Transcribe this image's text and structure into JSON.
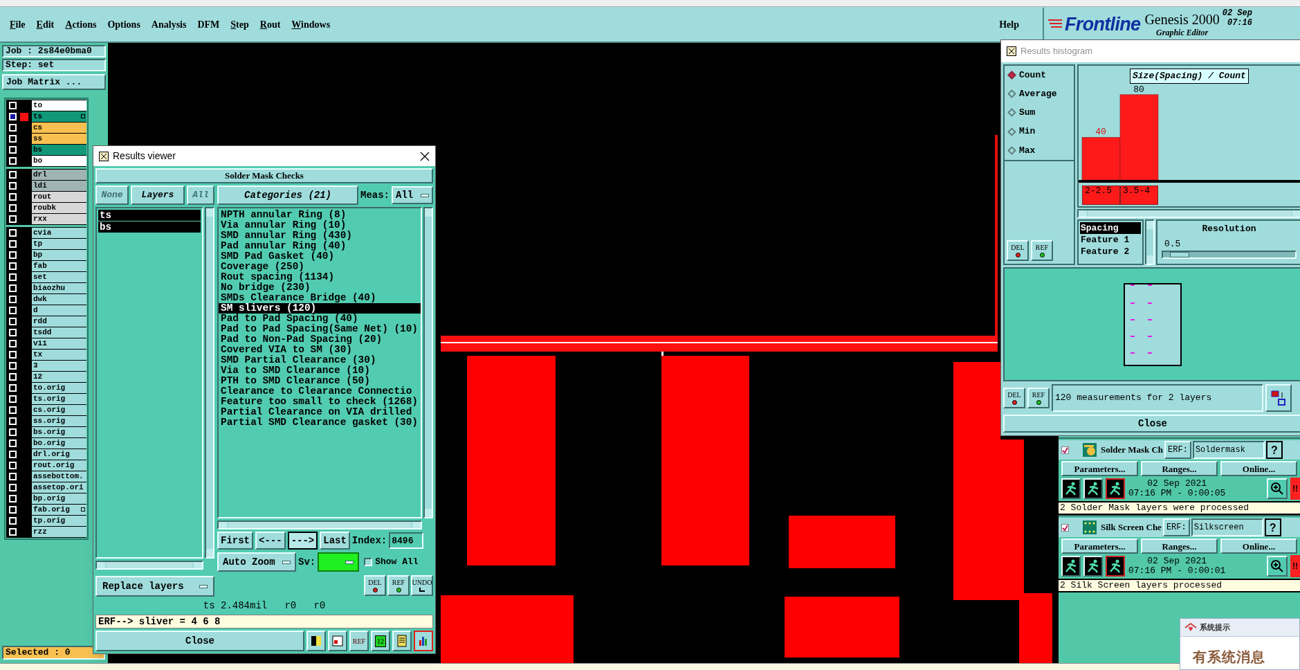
{
  "menu_bar": {
    "items": [
      {
        "label": "File",
        "mnemonic": true
      },
      {
        "label": "Edit",
        "mnemonic": true
      },
      {
        "label": "Actions",
        "mnemonic": true
      },
      {
        "label": "Options",
        "mnemonic": false
      },
      {
        "label": "Analysis",
        "mnemonic": false
      },
      {
        "label": "DFM",
        "mnemonic": false
      },
      {
        "label": "Step",
        "mnemonic": true
      },
      {
        "label": "Rout",
        "mnemonic": true
      },
      {
        "label": "Windows",
        "mnemonic": true
      }
    ],
    "help": {
      "label": "Help",
      "mnemonic": false
    }
  },
  "logo": {
    "brand": "Frontline",
    "product": "Genesis 2000",
    "subtitle": "Graphic Editor",
    "date": "02 Sep",
    "time": "07:16"
  },
  "job_panel": {
    "job": "Job : 2s84e0bma0",
    "step": "Step: set",
    "matrix_button": "Job Matrix ...",
    "layer_groups": [
      [
        {
          "name": "to",
          "color": "#ffffff",
          "selected": false
        },
        {
          "name": "ts",
          "color": "#109878",
          "selected": true,
          "flag": true
        },
        {
          "name": "cs",
          "color": "#f8c050",
          "selected": false
        },
        {
          "name": "ss",
          "color": "#f8c050",
          "selected": false
        },
        {
          "name": "bs",
          "color": "#109878",
          "selected": false
        },
        {
          "name": "bo",
          "color": "#ffffff",
          "selected": false
        }
      ],
      [
        {
          "name": "drl",
          "color": "#a0b4b4",
          "selected": false
        },
        {
          "name": "ldi",
          "color": "#a0b4b4",
          "selected": false
        },
        {
          "name": "rout",
          "color": "#d8d8d8",
          "selected": false
        },
        {
          "name": "roubk",
          "color": "#d8d8d8",
          "selected": false
        },
        {
          "name": "rxx",
          "color": "#d8d8d8",
          "selected": false
        }
      ],
      [
        {
          "name": "cvia",
          "color": "#a0dcdc",
          "selected": false
        },
        {
          "name": "tp",
          "color": "#a0dcdc",
          "selected": false
        },
        {
          "name": "bp",
          "color": "#a0dcdc",
          "selected": false
        },
        {
          "name": "fab",
          "color": "#a0dcdc",
          "selected": false
        },
        {
          "name": "set",
          "color": "#a0dcdc",
          "selected": false
        },
        {
          "name": "biaozhu",
          "color": "#a0dcdc",
          "selected": false
        },
        {
          "name": "dwk",
          "color": "#a0dcdc",
          "selected": false
        },
        {
          "name": "d",
          "color": "#a0dcdc",
          "selected": false
        },
        {
          "name": "rdd",
          "color": "#a0dcdc",
          "selected": false
        },
        {
          "name": "tsdd",
          "color": "#a0dcdc",
          "selected": false
        },
        {
          "name": "v11",
          "color": "#a0dcdc",
          "selected": false
        },
        {
          "name": "tx",
          "color": "#a0dcdc",
          "selected": false
        },
        {
          "name": "3",
          "color": "#a0dcdc",
          "selected": false
        },
        {
          "name": "12",
          "color": "#a0dcdc",
          "selected": false
        },
        {
          "name": "to.orig",
          "color": "#a0dcdc",
          "selected": false
        },
        {
          "name": "ts.orig",
          "color": "#a0dcdc",
          "selected": false
        },
        {
          "name": "cs.orig",
          "color": "#a0dcdc",
          "selected": false
        },
        {
          "name": "ss.orig",
          "color": "#a0dcdc",
          "selected": false
        },
        {
          "name": "bs.orig",
          "color": "#a0dcdc",
          "selected": false
        },
        {
          "name": "bo.orig",
          "color": "#a0dcdc",
          "selected": false
        },
        {
          "name": "drl.orig",
          "color": "#a0dcdc",
          "selected": false
        },
        {
          "name": "rout.orig",
          "color": "#a0dcdc",
          "selected": false
        },
        {
          "name": "assebottom.",
          "color": "#a0dcdc",
          "selected": false
        },
        {
          "name": "assetop.ori",
          "color": "#a0dcdc",
          "selected": false
        },
        {
          "name": "bp.orig",
          "color": "#a0dcdc",
          "selected": false
        },
        {
          "name": "fab.orig",
          "color": "#a0dcdc",
          "selected": false,
          "flag": true
        },
        {
          "name": "tp.orig",
          "color": "#a0dcdc",
          "selected": false
        },
        {
          "name": "rzz",
          "color": "#a0dcdc",
          "selected": false
        }
      ]
    ],
    "selected_count": "Selected : 0"
  },
  "results_viewer": {
    "title": "Results viewer",
    "header": "Solder Mask Checks",
    "layer_buttons": [
      "None",
      "Layers",
      "All"
    ],
    "layers": [
      {
        "name": "ts",
        "selected": true
      },
      {
        "name": "bs",
        "selected": true
      }
    ],
    "categories_button": "Categories (21)",
    "meas_label": "Meas:",
    "meas_value": "All",
    "categories": [
      {
        "label": "NPTH annular Ring (8)",
        "selected": false
      },
      {
        "label": "Via annular Ring (10)",
        "selected": false
      },
      {
        "label": "SMD annular Ring (430)",
        "selected": false
      },
      {
        "label": "Pad annular Ring (40)",
        "selected": false
      },
      {
        "label": "SMD Pad Gasket (40)",
        "selected": false
      },
      {
        "label": "Coverage (250)",
        "selected": false
      },
      {
        "label": "Rout spacing (1134)",
        "selected": false
      },
      {
        "label": "No bridge (230)",
        "selected": false
      },
      {
        "label": "SMDs Clearance Bridge (40)",
        "selected": false
      },
      {
        "label": "SM slivers (120)",
        "selected": true
      },
      {
        "label": "Pad to Pad Spacing (40)",
        "selected": false
      },
      {
        "label": "Pad to Pad Spacing(Same Net) (10)",
        "selected": false
      },
      {
        "label": "Pad to Non-Pad Spacing (20)",
        "selected": false
      },
      {
        "label": "Covered VIA to SM (30)",
        "selected": false
      },
      {
        "label": "SMD Partial Clearance (30)",
        "selected": false
      },
      {
        "label": "Via to SMD Clearance (10)",
        "selected": false
      },
      {
        "label": "PTH to SMD Clearance (50)",
        "selected": false
      },
      {
        "label": "Clearance to Clearance Connectio",
        "selected": false
      },
      {
        "label": "Feature too small to check (1268)",
        "selected": false
      },
      {
        "label": "Partial Clearance on VIA drilled",
        "selected": false
      },
      {
        "label": "Partial SMD Clearance gasket (30)",
        "selected": false
      }
    ],
    "nav_buttons": [
      {
        "label": "First",
        "pressed": false
      },
      {
        "label": "<---",
        "pressed": false
      },
      {
        "label": "--->",
        "pressed": true
      },
      {
        "label": "Last",
        "pressed": false
      }
    ],
    "index_label": "Index:",
    "index_value": "8496",
    "zoom_mode": "Auto Zoom",
    "sv_label": "Sv:",
    "show_all": {
      "label": "Show All",
      "checked": false
    },
    "replace_mode": "Replace layers",
    "tool_buttons": [
      {
        "kind": "delete",
        "label": "DEL"
      },
      {
        "kind": "refresh",
        "label": "REF"
      },
      {
        "kind": "undo",
        "label": "UNDO"
      }
    ],
    "measurement": "ts 2.484mil   r0   r0",
    "erf_line": "ERF--> sliver = 4 6 8",
    "close": "Close",
    "bottom_tools": [
      {
        "kind": "figure",
        "selected": false
      },
      {
        "kind": "report",
        "selected": false
      },
      {
        "kind": "no-ref",
        "label": "REF",
        "selected": false
      },
      {
        "kind": "numbers",
        "label": "12",
        "selected": false
      },
      {
        "kind": "notes",
        "selected": false
      },
      {
        "kind": "histogram",
        "selected": true
      }
    ]
  },
  "histogram": {
    "title": "Results histogram",
    "modes": [
      {
        "label": "Count",
        "selected": true
      },
      {
        "label": "Average",
        "selected": false
      },
      {
        "label": "Sum",
        "selected": false
      },
      {
        "label": "Min",
        "selected": false
      },
      {
        "label": "Max",
        "selected": false
      }
    ],
    "side_tools": [
      {
        "kind": "delete",
        "label": "DEL"
      },
      {
        "kind": "refresh",
        "label": "REF"
      }
    ],
    "chart_data": {
      "type": "bar",
      "title": "Size(Spacing) / Count",
      "categories": [
        "2-2.5",
        "3.5-4"
      ],
      "series": [
        {
          "color": "#ff1a1a",
          "values": [
            40,
            80
          ]
        }
      ],
      "data_labels": true
    },
    "attributes": [
      {
        "label": "Spacing",
        "selected": true
      },
      {
        "label": "Feature 1",
        "selected": false
      },
      {
        "label": "Feature 2",
        "selected": false
      }
    ],
    "resolution_label": "Resolution",
    "resolution_value": "0.5",
    "resolution_slider": {
      "level": 0.05
    },
    "bottom_tools": [
      {
        "kind": "delete",
        "label": "DEL"
      },
      {
        "kind": "refresh",
        "label": "REF"
      }
    ],
    "summary": "120 measurements for 2 layers",
    "close": "Close"
  },
  "checks": [
    {
      "kind": "mask",
      "checked": true,
      "title": "Solder Mask Ch",
      "erf_label": "ERF:",
      "erf_value": "Soldermask",
      "help": "?",
      "buttons": [
        "Parameters...",
        "Ranges...",
        "Online..."
      ],
      "date": "02 Sep 2021",
      "time": "07:16 PM - 0:00:05",
      "alert": "!!",
      "message": "2 Solder Mask layers were processed"
    },
    {
      "kind": "silk",
      "checked": true,
      "title": "Silk Screen Che",
      "erf_label": "ERF:",
      "erf_value": "Silkscreen",
      "help": "?",
      "buttons": [
        "Parameters...",
        "Ranges...",
        "Online..."
      ],
      "date": "02 Sep 2021",
      "time": "07:16 PM - 0:00:01",
      "alert": "!!",
      "message": "2 Silk Screen layers processed"
    }
  ],
  "popup": {
    "title": "系统提示",
    "message": "有系统消息"
  }
}
